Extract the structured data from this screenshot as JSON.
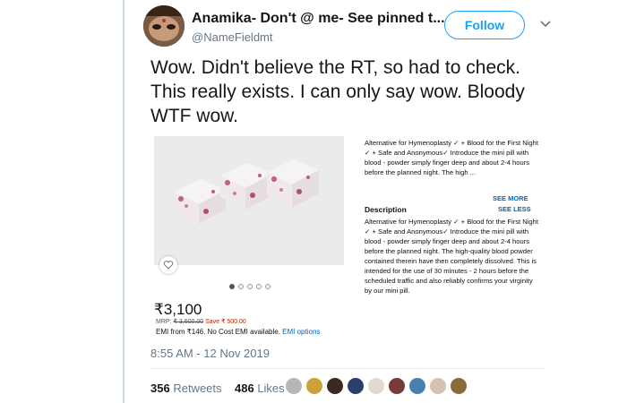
{
  "tweet": {
    "display_name": "Anamika- Don't @ me- See pinned t...",
    "handle": "@NameFieldmt",
    "follow_label": "Follow",
    "text": "Wow. Didn't believe the RT, so had to check. This really exists. I can only say wow. Bloody WTF wow.",
    "timestamp": "8:55 AM - 12 Nov 2019",
    "retweets_count": "356",
    "retweets_label": "Retweets",
    "likes_count": "486",
    "likes_label": "Likes"
  },
  "product": {
    "price": "₹3,100",
    "mrp_prefix": "MRP:",
    "mrp_value": "₹ 3,600.00",
    "save_text": "Save ₹ 500.00",
    "emi_text": "EMI from ₹146. No Cost EMI available.",
    "emi_link": "EMI options",
    "summary": "Alternative for Hymenoplasty ✓ + Blood for the First Night ✓ + Safe and Anonymous✓ Introduce the mini pill with blood - powder simply finger deep and about 2-4 hours before the planned night. The high ...",
    "see_more": "SEE MORE",
    "see_less": "SEE LESS",
    "description_title": "Description",
    "description_body": "Alternative for Hymenoplasty ✓ + Blood for the First Night ✓ + Safe and Anonymous✓ Introduce the mini pill with blood - powder simply finger deep and about 2-4 hours before the planned night. The high-quality blood powder contained therein have then completely dissolved. This is intended for the use of 30 minutes - 2 hours before the scheduled traffic and also reliably confirms your virginity by our mini pill.",
    "carousel_dots": 5,
    "carousel_active": 1
  },
  "colors": {
    "accent": "#1da1f2",
    "link": "#0066c0",
    "save": "#b12704",
    "liker_colors": [
      "#b7b7b7",
      "#c9a23a",
      "#3a2a20",
      "#2c3e6b",
      "#e4d9d0",
      "#7a3a3a",
      "#4a7fb0",
      "#d7c2b0",
      "#8a6a3a"
    ]
  },
  "icons": [
    "heart-icon",
    "chevron-down-icon"
  ]
}
